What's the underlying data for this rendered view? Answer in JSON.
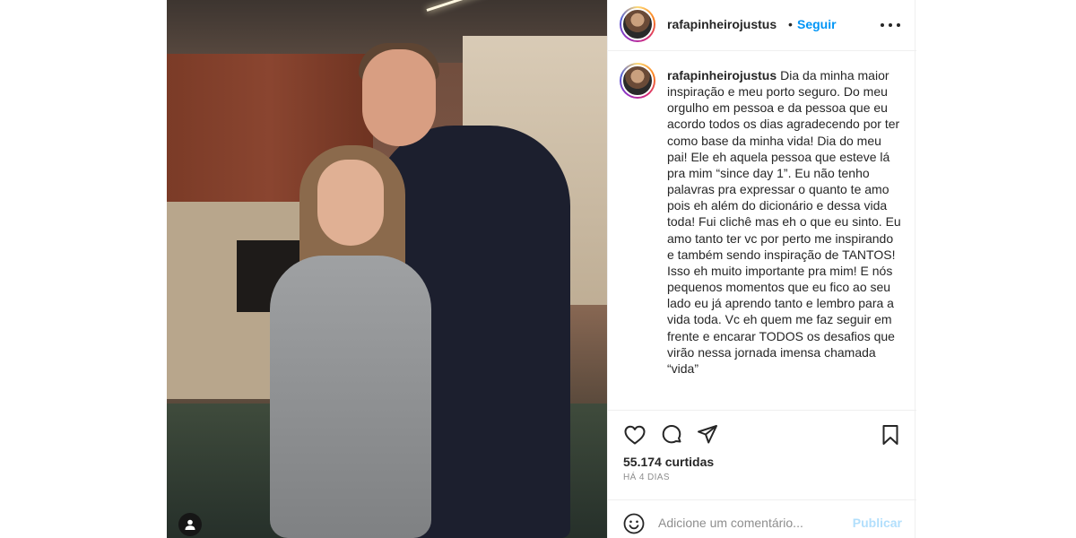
{
  "post": {
    "username": "rafapinheirojustus",
    "separator": "•",
    "follow_label": "Seguir",
    "caption": "Dia da minha maior inspiração e meu porto seguro. Do meu orgulho em pessoa e da pessoa que eu acordo todos os dias agradecendo por ter como base da minha vida! Dia do meu pai! Ele eh aquela pessoa que esteve lá pra mim “since day 1”. Eu não tenho palavras pra expressar o quanto te amo pois eh além do dicionário e dessa vida toda! Fui clichê mas eh o que eu sinto. Eu amo tanto ter vc por perto me inspirando e também sendo inspiração de TANTOS! Isso eh muito importante pra mim! E nós pequenos momentos que eu fico ao seu lado eu já aprendo tanto e lembro para a vida toda. Vc eh quem me faz seguir em frente e encarar TODOS os desafios que virão nessa jornada imensa chamada “vida”",
    "likes": "55.174 curtidas",
    "time_ago": "HÁ 4 DIAS"
  },
  "comment": {
    "placeholder": "Adicione um comentário...",
    "publish_label": "Publicar"
  },
  "icons": {
    "more": "more-options-icon",
    "like": "heart-icon",
    "comment": "comment-icon",
    "share": "paper-plane-icon",
    "save": "bookmark-icon",
    "emoji": "emoji-icon",
    "tags": "user-tag-icon"
  },
  "colors": {
    "accent": "#0095f6",
    "publish_disabled": "#b2dffc",
    "text": "#262626",
    "muted": "#8e8e8e"
  }
}
